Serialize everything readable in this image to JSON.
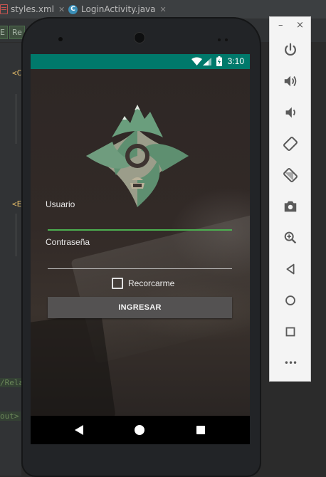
{
  "ide": {
    "tabs": [
      {
        "label": "styles.xml",
        "icon": "xml-file-icon"
      },
      {
        "label": "LoginActivity.java",
        "icon": "java-class-icon"
      }
    ],
    "toolbar_fragments": [
      "E",
      "Re"
    ],
    "code_fragments": [
      "<C",
      "<E",
      "/Rela",
      "out>"
    ]
  },
  "device": {
    "status_bar": {
      "time": "3:10",
      "icons": [
        "wifi-icon",
        "signal-icon",
        "battery-icon"
      ],
      "color": "#00796b"
    },
    "login": {
      "logo": "mountain-tree-logo",
      "username_label": "Usuario",
      "username_value": "",
      "password_label": "Contraseña",
      "password_value": "",
      "remember_label": "Recorcarme",
      "remember_checked": false,
      "submit_label": "INGRESAR",
      "accent_color": "#4caf50"
    },
    "nav_bar": [
      "back-icon",
      "home-icon",
      "recents-icon"
    ]
  },
  "emulator_toolbar": {
    "window_controls": [
      "minimize-icon",
      "close-icon"
    ],
    "minimize": "–",
    "close": "×",
    "buttons": [
      "power-icon",
      "volume-up-icon",
      "volume-down-icon",
      "rotate-left-icon",
      "rotate-right-icon",
      "screenshot-icon",
      "zoom-icon",
      "back-icon",
      "home-icon",
      "overview-icon",
      "more-icon"
    ],
    "more": "•••"
  }
}
